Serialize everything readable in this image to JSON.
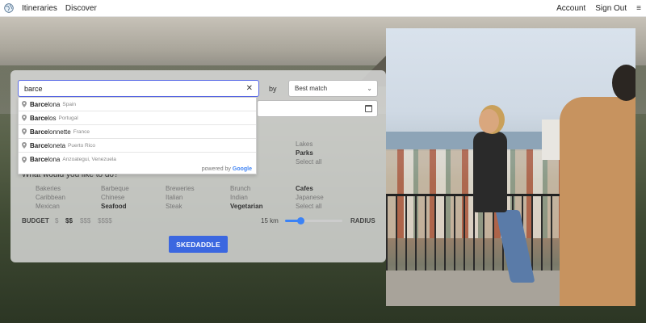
{
  "nav": {
    "links": [
      "Itineraries",
      "Discover"
    ],
    "right_links": [
      "Account",
      "Sign Out"
    ],
    "menu_icon": "≡",
    "logo_icon": "globe-icon"
  },
  "search": {
    "value": "barce",
    "placeholder": "",
    "clear_icon": "✕",
    "by_label": "by",
    "sort_selected": "Best match",
    "chevron_icon": "⌄"
  },
  "suggestions": [
    {
      "match": "Barce",
      "rest": "lona",
      "sub": "Spain"
    },
    {
      "match": "Barce",
      "rest": "los",
      "sub": "Portugal"
    },
    {
      "match": "Barce",
      "rest": "lonnette",
      "sub": "France"
    },
    {
      "match": "Barce",
      "rest": "loneta",
      "sub": "Puerto Rico"
    },
    {
      "match": "Barce",
      "rest": "lona",
      "sub": "Anzoategui, Venezuela"
    }
  ],
  "powered_by": {
    "prefix": "powered by ",
    "brand": "Google"
  },
  "activities_partial": {
    "col1": "Lakes",
    "col2": "Parks",
    "col3": "Select all"
  },
  "food": {
    "title": "What would you like to do?",
    "row1": [
      "Bakeries",
      "Barbeque",
      "Breweries",
      "Brunch",
      "Cafes"
    ],
    "row2": [
      "Caribbean",
      "Chinese",
      "Italian",
      "Indian",
      "Japanese"
    ],
    "row3": [
      "Mexican",
      "Seafood",
      "Steak",
      "Vegetarian",
      "Select all"
    ]
  },
  "budget": {
    "label": "BUDGET",
    "options": [
      "$",
      "$$",
      "$$$",
      "$$$$"
    ],
    "selected_index": 1
  },
  "radius": {
    "value_text": "15 km",
    "label": "RADIUS",
    "fraction": 0.28
  },
  "submit_label": "SKEDADDLE",
  "colors": {
    "accent": "#3b67e0",
    "slider": "#3b82f6",
    "search_border": "#5869e6"
  }
}
